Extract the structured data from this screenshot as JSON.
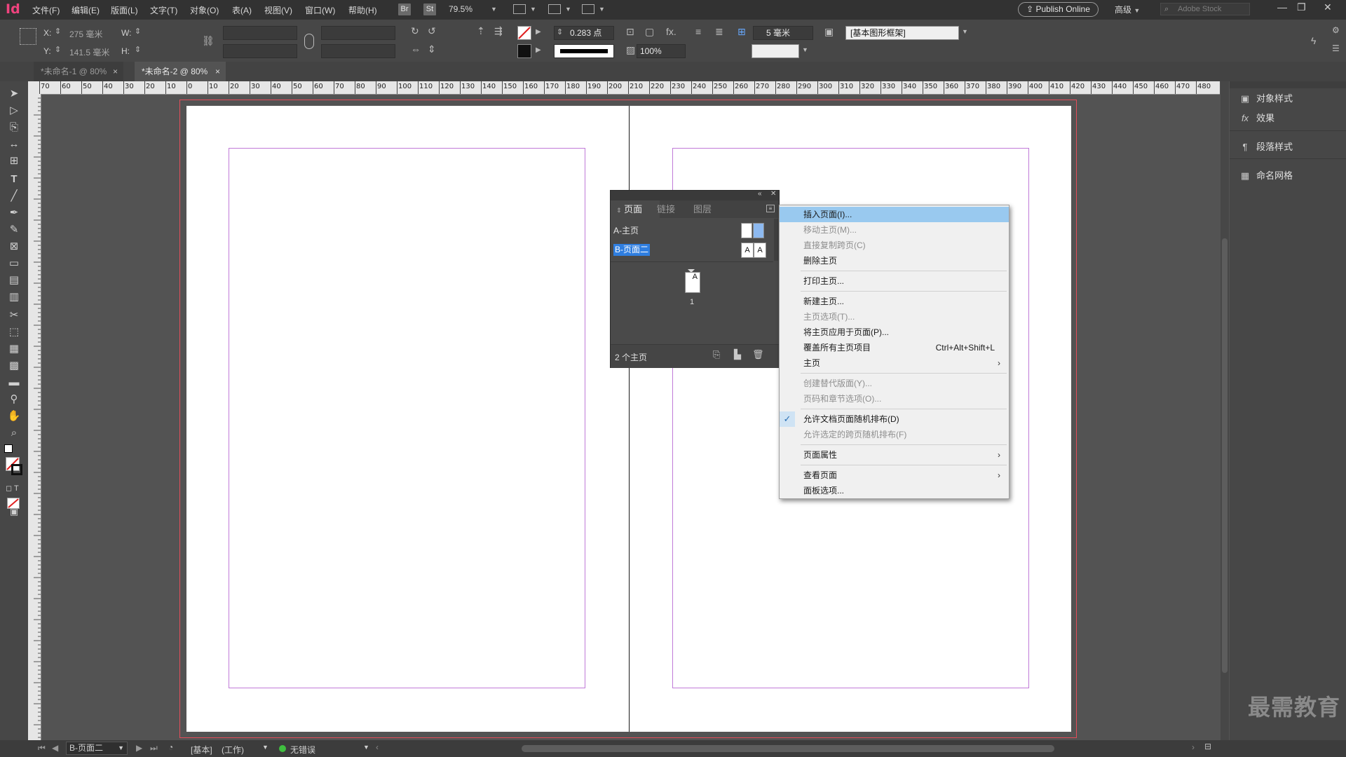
{
  "app": {
    "logo": "Id",
    "menu": [
      "文件(F)",
      "编辑(E)",
      "版面(L)",
      "文字(T)",
      "对象(O)",
      "表(A)",
      "视图(V)",
      "窗口(W)",
      "帮助(H)"
    ],
    "bridge_badge": "Br",
    "stock_badge": "St",
    "zoom": "79.5%",
    "publish_label": "Publish Online",
    "workspace": "高级",
    "search_placeholder": "Adobe Stock"
  },
  "control": {
    "x_label": "X:",
    "x_value": "275 毫米",
    "y_label": "Y:",
    "y_value": "141.5 毫米",
    "w_label": "W:",
    "h_label": "H:",
    "stroke_weight": "0.283 点",
    "scale": "100%",
    "spacing": "5 毫米",
    "frame_style": "[基本图形框架]"
  },
  "tabs": [
    {
      "label": "*未命名-1 @ 80%",
      "close": "×"
    },
    {
      "label": "*未命名-2 @ 80%",
      "close": "×"
    }
  ],
  "ruler_labels": [
    "70",
    "60",
    "50",
    "40",
    "30",
    "20",
    "10",
    "0",
    "10",
    "20",
    "30",
    "40",
    "50",
    "60",
    "70",
    "80",
    "90",
    "100",
    "110",
    "120",
    "130",
    "140",
    "150",
    "160",
    "170",
    "180",
    "190",
    "200",
    "210",
    "220",
    "230",
    "240",
    "250",
    "260",
    "270",
    "280",
    "290",
    "300",
    "310",
    "320",
    "330",
    "340",
    "350",
    "360",
    "370",
    "380",
    "390",
    "400",
    "410",
    "420",
    "430",
    "440",
    "450",
    "460",
    "470",
    "480"
  ],
  "right_panel": [
    {
      "label": "对象样式",
      "icon": "object-styles-icon",
      "glyph": "▣"
    },
    {
      "label": "效果",
      "icon": "fx-icon",
      "glyph": "fx"
    },
    {
      "label": "段落样式",
      "icon": "paragraph-styles-icon",
      "glyph": "¶"
    },
    {
      "label": "命名网格",
      "icon": "named-grid-icon",
      "glyph": "▦"
    }
  ],
  "watermark": "最需教育",
  "pages_panel": {
    "tabs": [
      "页面",
      "链接",
      "图层"
    ],
    "master_a": "A-主页",
    "master_b": "B-页面二",
    "thumb_letter": "A",
    "page_number": "1",
    "footer": "2 个主页"
  },
  "context_menu": [
    {
      "label": "插入页面(I)...",
      "state": "highlighted"
    },
    {
      "label": "移动主页(M)...",
      "state": "disabled"
    },
    {
      "label": "直接复制跨页(C)",
      "state": "disabled"
    },
    {
      "label": "删除主页",
      "state": "normal"
    },
    {
      "sep": true
    },
    {
      "label": "打印主页...",
      "state": "normal"
    },
    {
      "sep": true
    },
    {
      "label": "新建主页...",
      "state": "normal"
    },
    {
      "label": "主页选项(T)...",
      "state": "disabled"
    },
    {
      "label": "将主页应用于页面(P)...",
      "state": "normal"
    },
    {
      "label": "覆盖所有主页项目",
      "state": "normal",
      "shortcut": "Ctrl+Alt+Shift+L"
    },
    {
      "label": "主页",
      "state": "normal",
      "submenu": true
    },
    {
      "sep": true
    },
    {
      "label": "创建替代版面(Y)...",
      "state": "disabled"
    },
    {
      "label": "页码和章节选项(O)...",
      "state": "disabled"
    },
    {
      "sep": true
    },
    {
      "label": "允许文档页面随机排布(D)",
      "state": "checked"
    },
    {
      "label": "允许选定的跨页随机排布(F)",
      "state": "disabled"
    },
    {
      "sep": true
    },
    {
      "label": "页面属性",
      "state": "normal",
      "submenu": true
    },
    {
      "sep": true
    },
    {
      "label": "查看页面",
      "state": "normal",
      "submenu": true
    },
    {
      "label": "面板选项...",
      "state": "normal"
    }
  ],
  "status": {
    "page_field": "B-页面二",
    "preflight_profile": "[基本]",
    "preflight_mode": "(工作)",
    "errors": "无错误",
    "ok_color": "#3fbf3f"
  }
}
